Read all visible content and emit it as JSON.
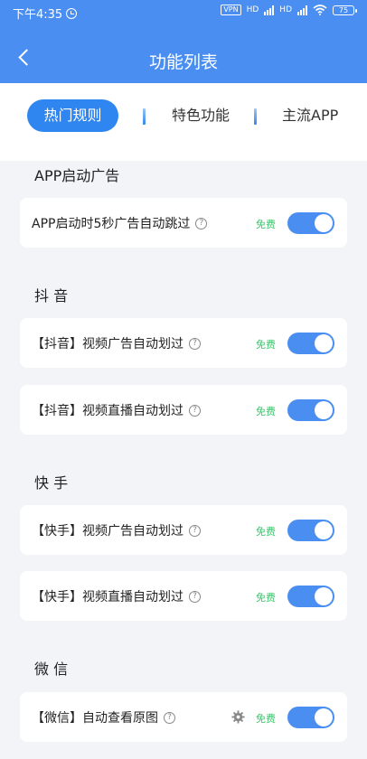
{
  "status": {
    "time": "下午4:35",
    "vpn": "VPN",
    "net1": "HD",
    "net2": "HD",
    "battery": "75"
  },
  "nav": {
    "title": "功能列表"
  },
  "tabs": [
    "热门规则",
    "特色功能",
    "主流APP"
  ],
  "free_label": "免费",
  "sections": [
    {
      "title": "APP启动广告",
      "items": [
        "APP启动时5秒广告自动跳过"
      ]
    },
    {
      "title": "抖 音",
      "items": [
        "【抖音】视频广告自动划过",
        "【抖音】视频直播自动划过"
      ]
    },
    {
      "title": "快 手",
      "items": [
        "【快手】视频广告自动划过",
        "【快手】视频直播自动划过"
      ]
    },
    {
      "title": "微 信",
      "items": [
        "【微信】自动查看原图"
      ]
    }
  ],
  "colors": {
    "primary": "#4a8ef2",
    "tab_active": "#2f86f0",
    "free": "#3ec36e",
    "background": "#f2f4f7"
  }
}
